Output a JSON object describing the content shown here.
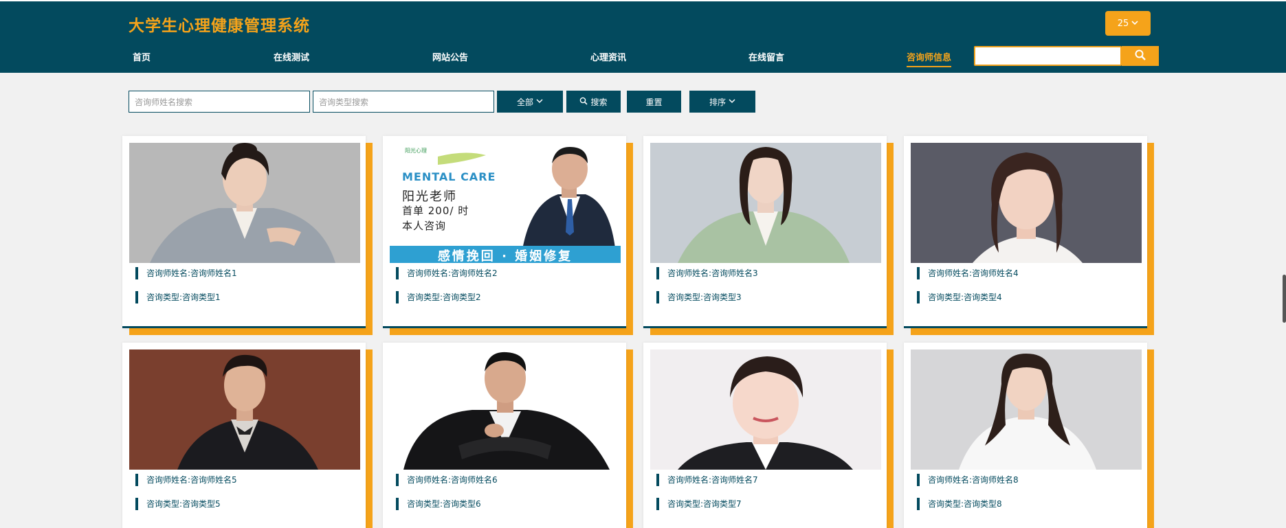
{
  "header": {
    "title": "大学生心理健康管理系统",
    "user_label": "25",
    "nav": [
      "首页",
      "在线测试",
      "网站公告",
      "心理资讯",
      "在线留言",
      "咨询师信息"
    ],
    "active_nav": "咨询师信息",
    "search_value": ""
  },
  "filters": {
    "name_placeholder": "咨询师姓名搜索",
    "type_placeholder": "咨询类型搜索",
    "all_label": "全部",
    "search_label": "搜索",
    "reset_label": "重置",
    "sort_label": "排序"
  },
  "banner": {
    "brand": "阳光心理",
    "mental_care": "MENTAL CARE",
    "line1": "阳光老师",
    "line2": "首单 200/ 时",
    "line3": "本人咨询",
    "bottom": "感情挽回 · 婚姻修复"
  },
  "counselors": [
    {
      "name": "咨询师姓名:咨询师姓名1",
      "type": "咨询类型:咨询类型1"
    },
    {
      "name": "咨询师姓名:咨询师姓名2",
      "type": "咨询类型:咨询类型2"
    },
    {
      "name": "咨询师姓名:咨询师姓名3",
      "type": "咨询类型:咨询类型3"
    },
    {
      "name": "咨询师姓名:咨询师姓名4",
      "type": "咨询类型:咨询类型4"
    },
    {
      "name": "咨询师姓名:咨询师姓名5",
      "type": "咨询类型:咨询类型5"
    },
    {
      "name": "咨询师姓名:咨询师姓名6",
      "type": "咨询类型:咨询类型6"
    },
    {
      "name": "咨询师姓名:咨询师姓名7",
      "type": "咨询类型:咨询类型7"
    },
    {
      "name": "咨询师姓名:咨询师姓名8",
      "type": "咨询类型:咨询类型8"
    }
  ],
  "colors": {
    "primary": "#034a5e",
    "accent": "#f5a31a",
    "background": "#f1f1f1"
  }
}
